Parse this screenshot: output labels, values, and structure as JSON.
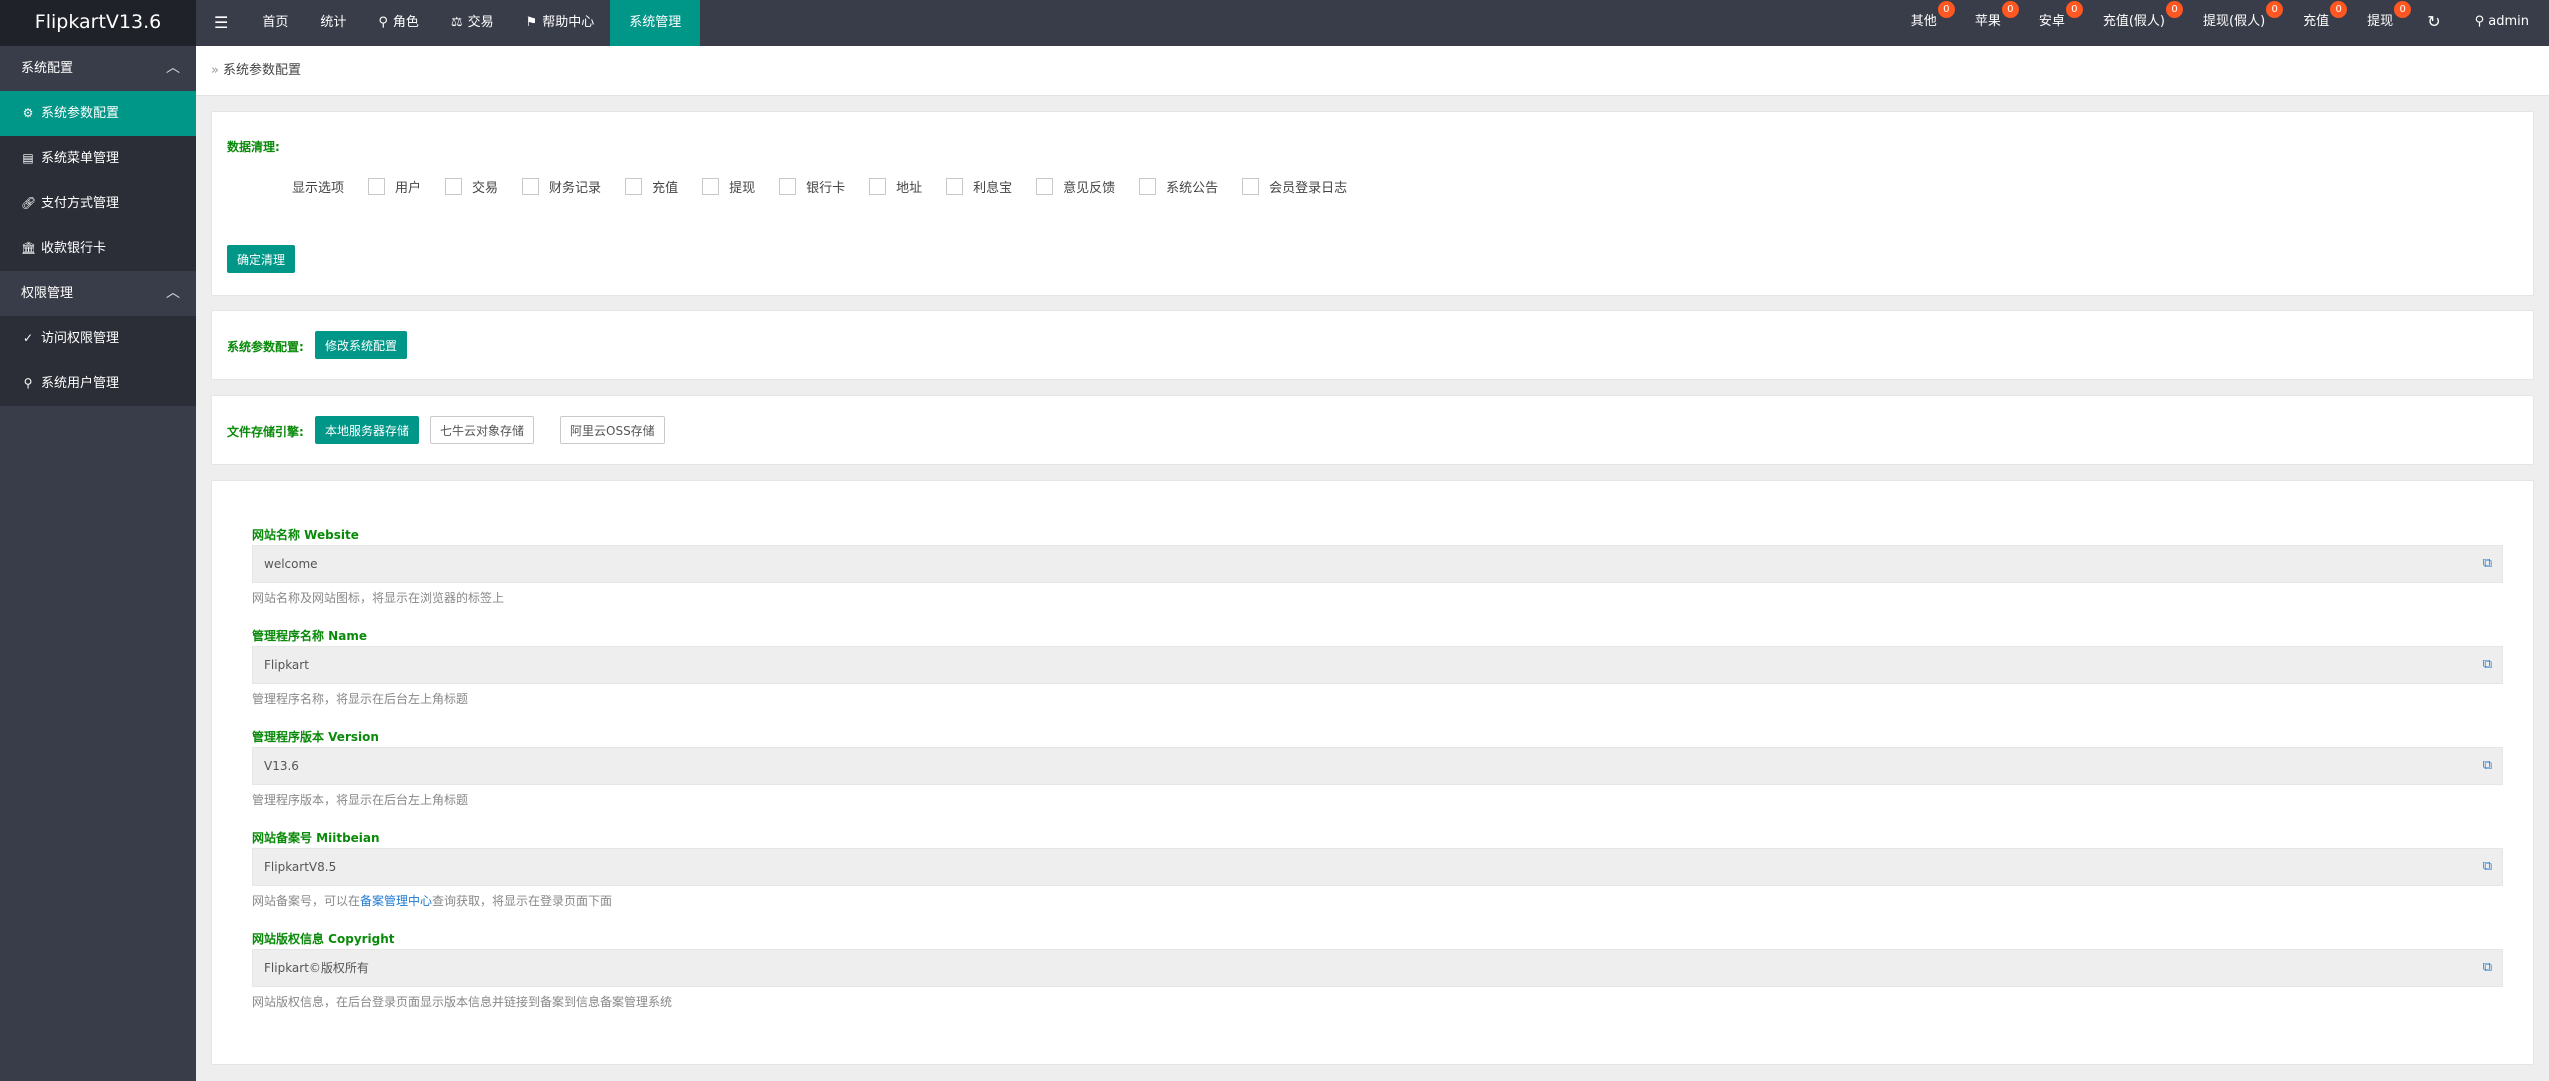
{
  "app": {
    "title": "FlipkartV13.6"
  },
  "topnav": {
    "menu_icon": "menu-icon",
    "items": [
      {
        "label": "首页",
        "icon": ""
      },
      {
        "label": "统计",
        "icon": ""
      },
      {
        "label": "角色",
        "icon": "user-icon"
      },
      {
        "label": "交易",
        "icon": "scale-icon"
      },
      {
        "label": "帮助中心",
        "icon": "flag-icon"
      },
      {
        "label": "系统管理",
        "icon": "",
        "active": true
      }
    ]
  },
  "topright": {
    "items": [
      {
        "label": "其他",
        "badge": "0"
      },
      {
        "label": "苹果",
        "badge": "0"
      },
      {
        "label": "安卓",
        "badge": "0"
      },
      {
        "label": "充值(假人)",
        "badge": "0"
      },
      {
        "label": "提现(假人)",
        "badge": "0"
      },
      {
        "label": "充值",
        "badge": "0"
      },
      {
        "label": "提现",
        "badge": "0"
      }
    ],
    "refresh_icon": "refresh-icon",
    "user": "admin"
  },
  "sidebar": {
    "group1": "系统配置",
    "items1": [
      {
        "label": "系统参数配置",
        "icon": "gear-icon",
        "active": true
      },
      {
        "label": "系统菜单管理",
        "icon": "menu-table-icon"
      },
      {
        "label": "支付方式管理",
        "icon": "link-icon"
      },
      {
        "label": "收款银行卡",
        "icon": "bank-icon"
      }
    ],
    "group2": "权限管理",
    "items2": [
      {
        "label": "访问权限管理",
        "icon": "shield-check-icon"
      },
      {
        "label": "系统用户管理",
        "icon": "user-icon"
      }
    ]
  },
  "breadcrumb": {
    "label": "系统参数配置"
  },
  "cleanup": {
    "title": "数据清理:",
    "options_label": "显示选项",
    "options": [
      "用户",
      "交易",
      "财务记录",
      "充值",
      "提现",
      "银行卡",
      "地址",
      "利息宝",
      "意见反馈",
      "系统公告",
      "会员登录日志"
    ],
    "confirm_button": "确定清理"
  },
  "sysparams": {
    "label": "系统参数配置:",
    "button": "修改系统配置"
  },
  "storage": {
    "label": "文件存储引擎:",
    "buttons": [
      "本地服务器存储",
      "七牛云对象存储",
      "阿里云OSS存储"
    ]
  },
  "fields": [
    {
      "label": "网站名称 Website",
      "value": "welcome",
      "help": "网站名称及网站图标，将显示在浏览器的标签上"
    },
    {
      "label": "管理程序名称 Name",
      "value": "Flipkart",
      "help": "管理程序名称，将显示在后台左上角标题"
    },
    {
      "label": "管理程序版本 Version",
      "value": "V13.6",
      "help": "管理程序版本，将显示在后台左上角标题"
    },
    {
      "label": "网站备案号 Miitbeian",
      "value": "FlipkartV8.5",
      "help_pre": "网站备案号，可以在",
      "help_link": "备案管理中心",
      "help_post": "查询获取，将显示在登录页面下面"
    },
    {
      "label": "网站版权信息 Copyright",
      "value": "Flipkart©版权所有",
      "help": "网站版权信息，在后台登录页面显示版本信息并链接到备案到信息备案管理系统"
    }
  ],
  "colors": {
    "accent": "#009688",
    "topbar": "#393d49",
    "badge": "#ff5722",
    "label_green": "#0a8a0a"
  }
}
